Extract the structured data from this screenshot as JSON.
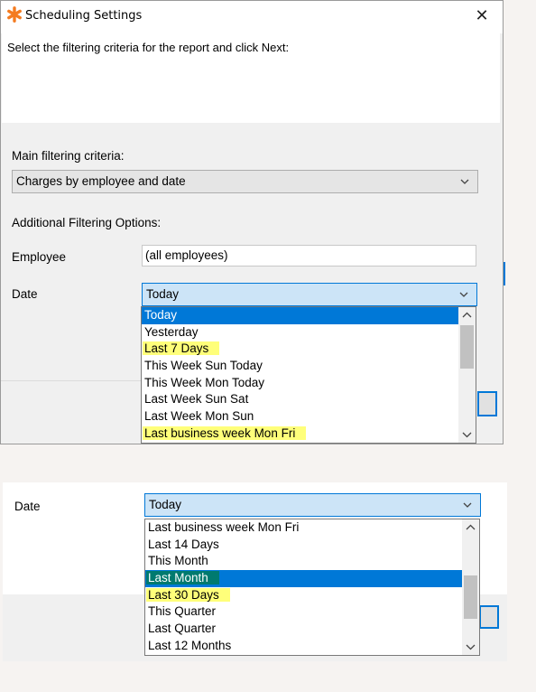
{
  "window": {
    "title": "Scheduling Settings",
    "close_glyph": "✕",
    "instruction": "Select the filtering criteria for the report and click Next:"
  },
  "main_criteria": {
    "label": "Main filtering criteria:",
    "value": "Charges by employee and date"
  },
  "additional": {
    "label": "Additional Filtering Options:"
  },
  "employee": {
    "label": "Employee",
    "value": "(all employees)"
  },
  "date": {
    "label": "Date",
    "value": "Today",
    "dropdown_top": [
      {
        "label": "Today",
        "state": "selected"
      },
      {
        "label": "Yesterday",
        "state": "normal"
      },
      {
        "label": "Last 7 Days",
        "state": "highlighted"
      },
      {
        "label": "This Week Sun Today",
        "state": "normal"
      },
      {
        "label": "This Week Mon Today",
        "state": "normal"
      },
      {
        "label": "Last Week Sun Sat",
        "state": "normal"
      },
      {
        "label": "Last Week Mon Sun",
        "state": "normal"
      },
      {
        "label": "Last business week Mon Fri",
        "state": "highlighted"
      }
    ]
  },
  "lower_panel": {
    "date_label": "Date",
    "date_value": "Today",
    "dropdown_items": [
      {
        "label": "Last business week Mon Fri",
        "state": "normal"
      },
      {
        "label": "Last 14 Days",
        "state": "normal"
      },
      {
        "label": "This Month",
        "state": "normal"
      },
      {
        "label": "Last Month",
        "state": "selected-highlighted"
      },
      {
        "label": "Last 30 Days",
        "state": "highlighted"
      },
      {
        "label": "This Quarter",
        "state": "normal"
      },
      {
        "label": "Last Quarter",
        "state": "normal"
      },
      {
        "label": "Last 12 Months",
        "state": "normal"
      }
    ]
  },
  "icons": {
    "app": "orange-asterisk-icon",
    "close": "close-icon",
    "dropdown": "chevron-down-icon",
    "scroll_up": "chevron-up-icon",
    "scroll_down": "chevron-down-icon"
  },
  "colors": {
    "selection": "#0078d7",
    "highlight": "#ffff7a",
    "selected_highlight": "#007a6f",
    "app_icon": "#f47b20"
  }
}
